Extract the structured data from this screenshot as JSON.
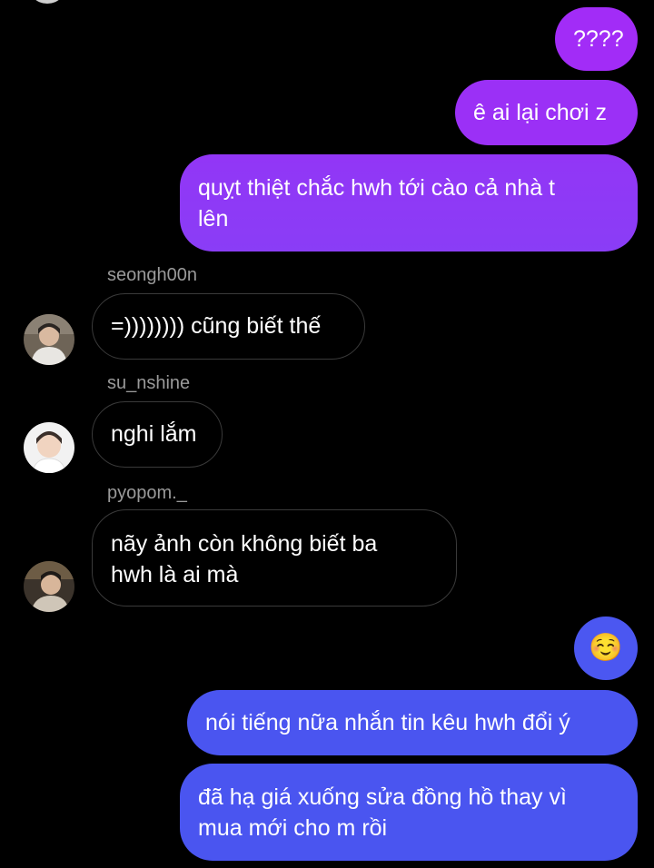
{
  "colors": {
    "background": "#000000",
    "outgoing_purple": "#a22cf7",
    "outgoing_violet": "#8a3df6",
    "outgoing_blue": "#4a55f0",
    "incoming_border": "#3a3a3a",
    "sender_text": "#9a9a9a"
  },
  "messages": [
    {
      "type": "outgoing",
      "text": "????"
    },
    {
      "type": "outgoing",
      "text": "ê ai lại chơi z"
    },
    {
      "type": "outgoing",
      "text": "quỵt thiệt chắc hwh tới cào cả nhà t\nlên"
    },
    {
      "type": "incoming",
      "sender": "seongh00n",
      "avatar": "avatar-seongh00n",
      "text": "=)))))))) cũng biết thế"
    },
    {
      "type": "incoming",
      "sender": "su_nshine",
      "avatar": "avatar-su_nshine",
      "text": "nghi lắm"
    },
    {
      "type": "incoming",
      "sender": "pyopom._",
      "avatar": "avatar-pyopom",
      "text": "nãy ảnh còn không biết ba\nhwh là ai mà"
    },
    {
      "type": "outgoing",
      "text": "☺️",
      "icon": "smiling-face-emoji-icon"
    },
    {
      "type": "outgoing",
      "text": "nói tiếng nữa nhắn tin kêu hwh đổi ý"
    },
    {
      "type": "outgoing",
      "text": "đã hạ giá xuống sửa đồng hồ thay vì\nmua mới cho m rồi"
    }
  ]
}
